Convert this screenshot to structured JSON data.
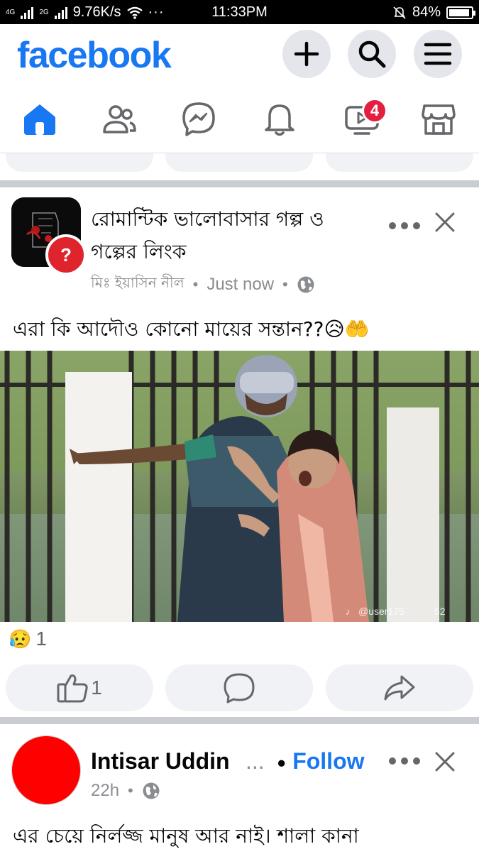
{
  "status_bar": {
    "network": "4G",
    "network2": "2G",
    "speed": "9.76K/s",
    "time": "11:33PM",
    "battery": "84%",
    "battery_level": 0.84
  },
  "header": {
    "logo": "facebook",
    "icons": [
      "plus-icon",
      "search-icon",
      "menu-icon"
    ]
  },
  "nav": {
    "items": [
      "home",
      "friends",
      "messenger",
      "notifications",
      "video",
      "marketplace"
    ],
    "active": "home",
    "video_badge": "4"
  },
  "colors": {
    "brand": "#1877f2",
    "badge": "#e41e3f",
    "separator": "#c9ccd1",
    "meta": "#8a8d91"
  },
  "post1": {
    "page_title": "রোমান্টিক ভালোবাসার  গল্প ও গল্পের লিংক",
    "author": "মিঃ ইয়াসিন নীল",
    "time": "Just now",
    "caption": "এরা কি আদৌও কোনো মায়ের সন্তান??😥🤲",
    "watermark": "@user175",
    "watermark_tail": "52",
    "reaction_emoji": "😥",
    "reaction_count": "1",
    "like_count": "1"
  },
  "post2": {
    "author": "Intisar Uddin",
    "ellipsis": "...",
    "follow": "Follow",
    "time": "22h",
    "caption": "এর চেয়ে নির্লজ্জ মানুষ আর নাই। শালা কানা"
  }
}
